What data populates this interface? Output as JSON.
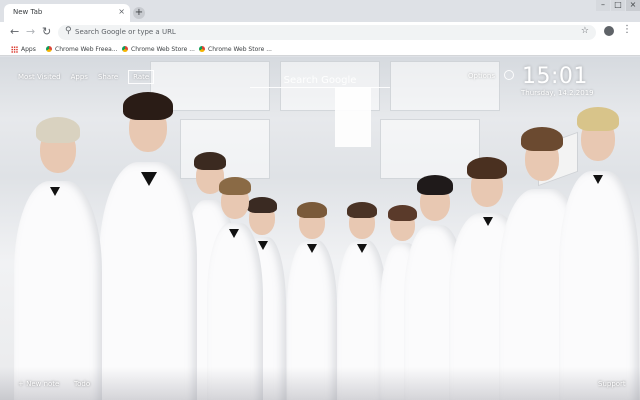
{
  "browser": {
    "tab": {
      "title": "New Tab",
      "close": "×"
    },
    "new_tab": "+",
    "window_controls": {
      "minimize": "–",
      "maximize": "□",
      "close": "×"
    },
    "nav": {
      "back": "←",
      "forward": "→",
      "reload": "↻"
    },
    "omnibox": {
      "placeholder": "Search Google or type a URL",
      "search_glyph": "⚲",
      "star": "☆"
    },
    "menu": "⋮",
    "bookmarks": [
      {
        "label": "Apps"
      },
      {
        "label": "Chrome Web Freea..."
      },
      {
        "label": "Chrome Web Store ..."
      },
      {
        "label": "Chrome Web Store ..."
      }
    ]
  },
  "newtab": {
    "nav": [
      "Most Visited",
      "Apps",
      "Share",
      "Rate"
    ],
    "search_placeholder": "Search Google",
    "options_label": "Options",
    "time": "15:01",
    "date": "Thursday, 14.2.2019",
    "bottom_left": {
      "new_note": "+ New note",
      "todo": "Todo"
    },
    "bottom_right": "Support"
  },
  "colors": {
    "tabstrip": "#dee1e6",
    "toolbar": "#ffffff",
    "omnibox": "#f1f3f4",
    "overlay_text": "#ffffff"
  },
  "icons": {
    "back": "arrow-left-icon",
    "forward": "arrow-right-icon",
    "reload": "reload-icon",
    "bookmark": "star-icon",
    "profile": "profile-icon",
    "menu": "kebab-menu-icon",
    "apps": "apps-grid-icon"
  }
}
